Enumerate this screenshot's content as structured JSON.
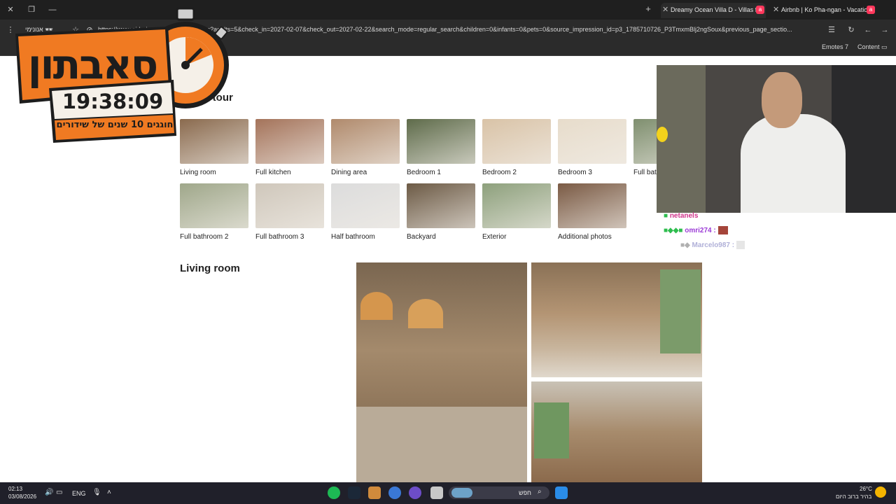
{
  "browser": {
    "tabs": [
      {
        "label": "Dreamy Ocean Villa D - Villas f"
      },
      {
        "label": "Airbnb | Ko Pha-ngan - Vacatio"
      }
    ],
    "new_tab": "+",
    "incognito_label": "אנונימי",
    "url": "https://www.airbnb.com/rooms/.../photos?adults=5&check_in=2027-02-07&check_out=2027-02-22&search_mode=regular_search&children=0&infants=0&pets=0&source_impression_id=p3_1785710726_P3TmxmBlj2ngSoux&previous_page_sectio...",
    "bookmarks": {
      "emotes": "Emotes",
      "content": "Content"
    }
  },
  "page": {
    "tour_title": "Photo tour",
    "thumbnails_row1": [
      {
        "label": "Living room",
        "color": "#8a6a4e"
      },
      {
        "label": "Full kitchen",
        "color": "#a4735a"
      },
      {
        "label": "Dining area",
        "color": "#b08a6c"
      },
      {
        "label": "Bedroom 1",
        "color": "#5e6b4a"
      },
      {
        "label": "Bedroom 2",
        "color": "#d9c3a7"
      },
      {
        "label": "Bedroom 3",
        "color": "#e7dccb"
      },
      {
        "label": "Full bat",
        "color": "#7f8f6f"
      }
    ],
    "thumbnails_row2": [
      {
        "label": "Full bathroom 2",
        "color": "#9fa78a"
      },
      {
        "label": "Full bathroom 3",
        "color": "#cfc7bb"
      },
      {
        "label": "Half bathroom",
        "color": "#dcdcdc"
      },
      {
        "label": "Backyard",
        "color": "#6c5a45"
      },
      {
        "label": "Exterior",
        "color": "#8da07c"
      },
      {
        "label": "Additional photos",
        "color": "#7a5a44"
      }
    ],
    "living_room_title": "Living room"
  },
  "overlay": {
    "logo_text": "סאבתון",
    "timer": "19:38:09",
    "subtitle": "חוגגים 10 שנים של שידורים",
    "chat": [
      {
        "user": "netanels",
        "color": "#d0348a"
      },
      {
        "user": "omri274",
        "sep": ":",
        "color": "#9b3bd6"
      },
      {
        "user": "Marcelo987",
        "sep": ":",
        "color": "#b0b0d8"
      }
    ]
  },
  "taskbar": {
    "time": "02:13",
    "date": "03/08/2026",
    "lang": "ENG",
    "search_placeholder": "חפש",
    "weather_temp": "26°C",
    "weather_desc": "בהיר ברוב היום"
  }
}
